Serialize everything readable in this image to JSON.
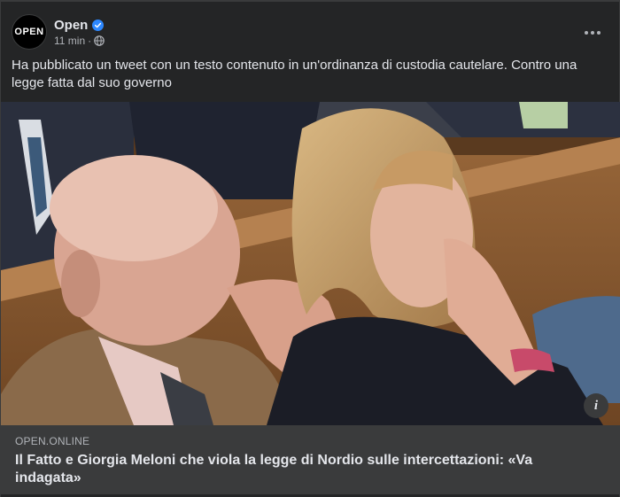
{
  "post": {
    "page_name": "Open",
    "avatar_text": "OPEN",
    "time": "11 min",
    "separator": "·",
    "privacy_icon": "globe-icon",
    "more_icon": "more-horizontal-icon",
    "verified_icon": "verified-badge-icon",
    "text": "Ha pubblicato un tweet con un testo contenuto in un'ordinanza di custodia cautelare. Contro una legge fatta dal suo governo"
  },
  "photo": {
    "info_icon": "info-icon",
    "info_glyph": "i"
  },
  "link": {
    "domain": "OPEN.ONLINE",
    "headline": "Il Fatto e Giorgia Meloni che viola la legge di Nordio sulle intercettazioni: «Va indagata»"
  },
  "colors": {
    "card_bg": "#242526",
    "preview_bg": "#3a3b3c",
    "verified": "#2d88ff",
    "text_primary": "#e4e6eb",
    "text_secondary": "#b0b3b8"
  }
}
